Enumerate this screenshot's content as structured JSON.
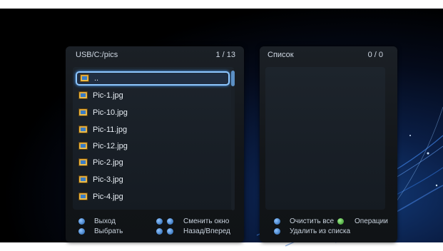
{
  "left_panel": {
    "path": "USB/C:/pics",
    "counter": "1 / 13",
    "items": [
      {
        "label": "..",
        "selected": true
      },
      {
        "label": "Pic-1.jpg",
        "selected": false
      },
      {
        "label": "Pic-10.jpg",
        "selected": false
      },
      {
        "label": "Pic-11.jpg",
        "selected": false
      },
      {
        "label": "Pic-12.jpg",
        "selected": false
      },
      {
        "label": "Pic-2.jpg",
        "selected": false
      },
      {
        "label": "Pic-3.jpg",
        "selected": false
      },
      {
        "label": "Pic-4.jpg",
        "selected": false
      }
    ],
    "hints": {
      "exit": "Выход",
      "select": "Выбрать",
      "switch_window": "Сменить окно",
      "back_forward": "Назад/Вперед"
    }
  },
  "right_panel": {
    "title": "Список",
    "counter": "0 / 0",
    "hints": {
      "clear_all": "Очистить все",
      "operations": "Операции",
      "remove_from_list": "Удалить из списка"
    }
  }
}
